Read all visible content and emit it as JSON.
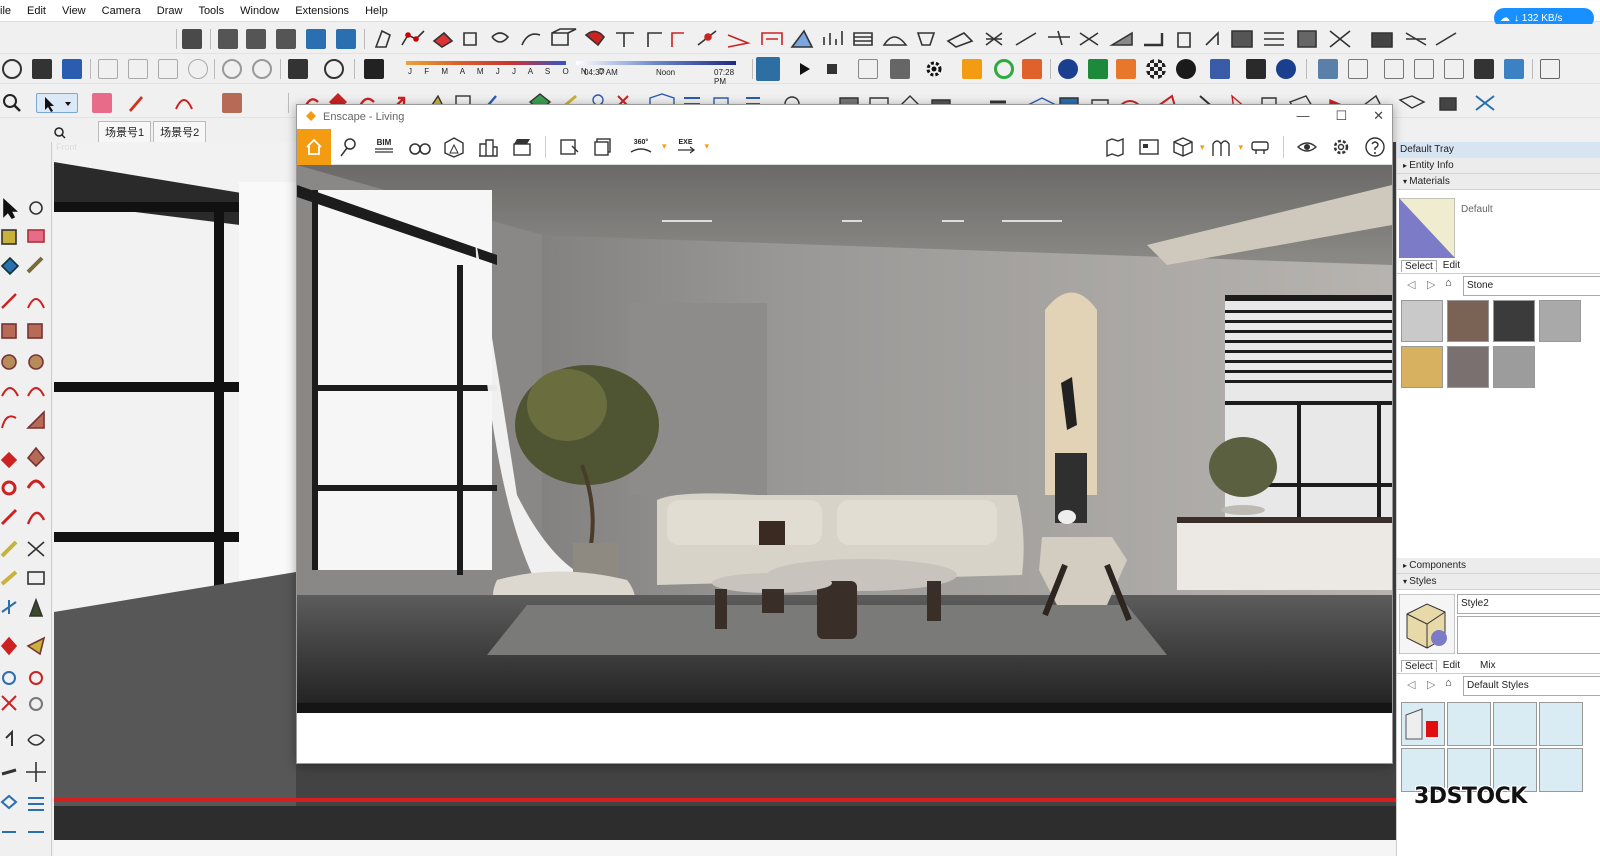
{
  "menu": [
    "ile",
    "Edit",
    "View",
    "Camera",
    "Draw",
    "Tools",
    "Window",
    "Extensions",
    "Help"
  ],
  "speed_badge": "↓ 132 KB/s",
  "shadow": {
    "months": "J F M A M J J A S O N D",
    "time_start": "04:37 AM",
    "noon": "Noon",
    "time_end": "07:28 PM"
  },
  "scene_tabs": [
    "场景号1",
    "场景号2"
  ],
  "viewport": {
    "camera_label": "Front"
  },
  "enscape": {
    "title": "Enscape - Living",
    "bim_label": "BIM",
    "pano_label": "360°",
    "exe_label": "EXE",
    "min": "—",
    "max": "☐",
    "close": "✕"
  },
  "tray": {
    "title": "Default Tray",
    "entity_info": "Entity Info",
    "materials": {
      "header": "Materials",
      "current": "Default",
      "tabs": [
        "Select",
        "Edit"
      ],
      "library": "Stone",
      "swatch_colors": [
        "#c9c9c9",
        "#7a6255",
        "#3b3b3b",
        "#a9a9a9",
        "#d8b160",
        "#7a7070",
        "#9c9c9c"
      ]
    },
    "components": "Components",
    "styles": {
      "header": "Styles",
      "current": "Style2",
      "tabs": [
        "Select",
        "Edit",
        "Mix"
      ],
      "library": "Default Styles"
    }
  },
  "watermark": "3DSTOCK",
  "colors": {
    "enscape_accent": "#f39c12",
    "badge_blue": "#1890ff",
    "tray_header": "#d7e4f2"
  }
}
